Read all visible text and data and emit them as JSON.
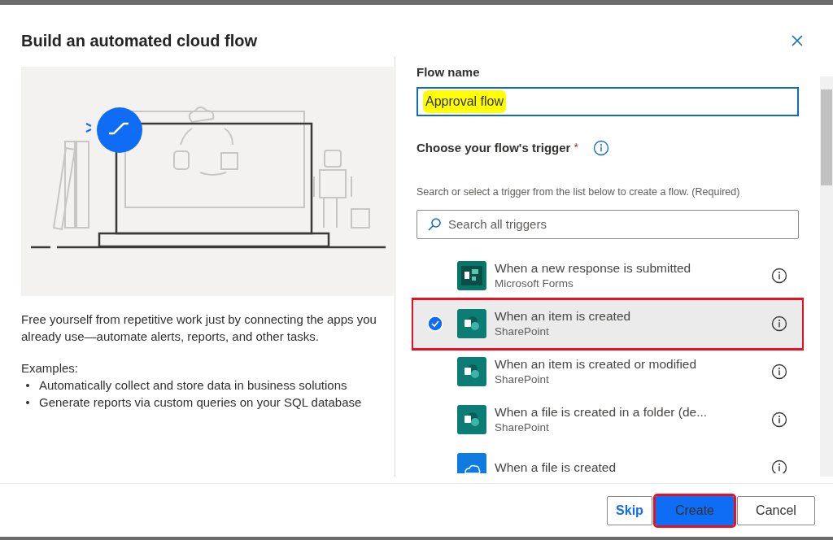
{
  "dialog": {
    "title": "Build an automated cloud flow"
  },
  "description": "Free yourself from repetitive work just by connecting the apps you already use—automate alerts, reports, and other tasks.",
  "examples": {
    "heading": "Examples:",
    "items": [
      "Automatically collect and store data in business solutions",
      "Generate reports via custom queries on your SQL database"
    ]
  },
  "flow_name": {
    "label": "Flow name",
    "value": "Approval flow",
    "highlighted": true
  },
  "trigger": {
    "label": "Choose your flow's trigger",
    "required_mark": "*",
    "hint": "Search or select a trigger from the list below to create a flow. (Required)",
    "search_placeholder": "Search all triggers"
  },
  "triggers": [
    {
      "kind": "forms",
      "title": "When a new response is submitted",
      "source": "Microsoft Forms",
      "selected": false,
      "highlighted": false
    },
    {
      "kind": "sharepoint",
      "title": "When an item is created",
      "source": "SharePoint",
      "selected": true,
      "highlighted": true
    },
    {
      "kind": "sharepoint",
      "title": "When an item is created or modified",
      "source": "SharePoint",
      "selected": false,
      "highlighted": false
    },
    {
      "kind": "sharepoint",
      "title": "When a file is created in a folder (de...",
      "source": "SharePoint",
      "selected": false,
      "highlighted": false
    },
    {
      "kind": "onedrive",
      "title": "When a file is created",
      "selected": false,
      "highlighted": false
    }
  ],
  "buttons": [
    {
      "kind": "link",
      "label": "Skip",
      "highlighted": false
    },
    {
      "kind": "primary",
      "label": "Create",
      "highlighted": true
    },
    {
      "kind": "default",
      "label": "Cancel",
      "highlighted": false
    }
  ]
}
